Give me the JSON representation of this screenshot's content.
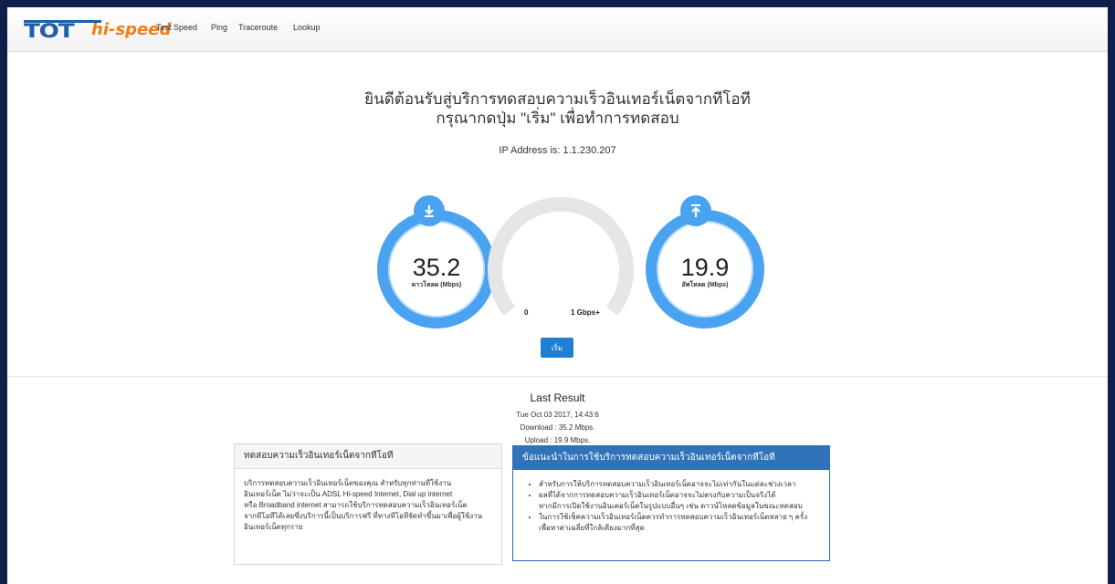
{
  "navbar": {
    "logo_main": "TOT",
    "logo_sub": "hi-speed",
    "links": [
      "Test Speed",
      "Ping",
      "Traceroute",
      "Lookup"
    ]
  },
  "welcome": {
    "line1": "ยินดีต้อนรับสู่บริการทดสอบความเร็วอินเทอร์เน็ตจากทีโอที",
    "line2": "กรุณากดปุ่ม \"เริ่ม\" เพื่อทำการทดสอบ"
  },
  "ip_line": "IP Address is: 1.1.230.207",
  "download": {
    "value": "35.2",
    "unit": "ดาวโหลด (Mbps)"
  },
  "upload": {
    "value": "19.9",
    "unit": "อัพโหลด (Mbps)"
  },
  "speed_gauge": {
    "min_label": "0",
    "max_label": "1 Gbps+",
    "level": 0
  },
  "start_button": "เริ่ม",
  "last_result": {
    "title": "Last Result",
    "date": "Tue Oct 03 2017, 14:43:6",
    "download": "Download : 35.2 Mbps.",
    "upload": "Upload : 19.9 Mbps."
  },
  "panel_left": {
    "title": "ทดสอบความเร็วอินเทอร์เน็ตจากทีโอที",
    "lines": [
      "บริการทดสอบความเร็วอินเทอร์เน็ตของคุณ สำหรับทุกท่านที่ใช้งาน",
      "อินเทอร์เน็ต ไม่ว่าจะเป็น ADSL Hi-speed Internet, Dial up internet",
      "หรือ Broadband internet สามารถใช้บริการทดสอบความเร็วอินเทอร์เน็ต",
      "จากทีโอทีได้เลยซึ่งบริการนี้เป็นบริการฟรี ที่ทางทีโอทีจัดทำขึ้นมาเพื่อผู้ใช้งาน",
      "อินเทอร์เน็ตทุกราย"
    ]
  },
  "panel_right": {
    "title": "ข้อแนะนำในการใช้บริการทดสอบความเร็วอินเทอร์เน็ตจากทีโอที",
    "bullets": [
      {
        "lines": [
          "สำหรับการให้บริการทดสอบความเร็วอินเทอร์เน็ตอาจจะไม่เท่ากันในแต่ละช่วงเวลา"
        ]
      },
      {
        "lines": [
          "ผลที่ได้จากการทดสอบความเร็วอินเทอร์เน็ตอาจจะไม่ตรงกับความเป็นจริงได้",
          "หากมีการเปิดใช้งานอินเตอร์เน็ตในรูปแบบอื่นๆ เช่น ดาวน์โหลดข้อมูลในขณะทดสอบ"
        ]
      },
      {
        "lines": [
          "ในการใช้เช็คความเร็วอินเทอร์เน็ตควรทำการทดสอบความเร็วอินเทอร์เน็ตหลาย ๆ ครั้ง",
          "เพื่อหาค่าเฉลี่ยที่ใกล้เคียงมากที่สุด"
        ]
      }
    ]
  },
  "colors": {
    "accent": "#4aa3f0",
    "button": "#1e7fd4",
    "panel_header": "#3173b8",
    "logo_blue": "#1f5fa8",
    "logo_orange": "#f07d1a",
    "page_border": "#0d1f4a"
  }
}
